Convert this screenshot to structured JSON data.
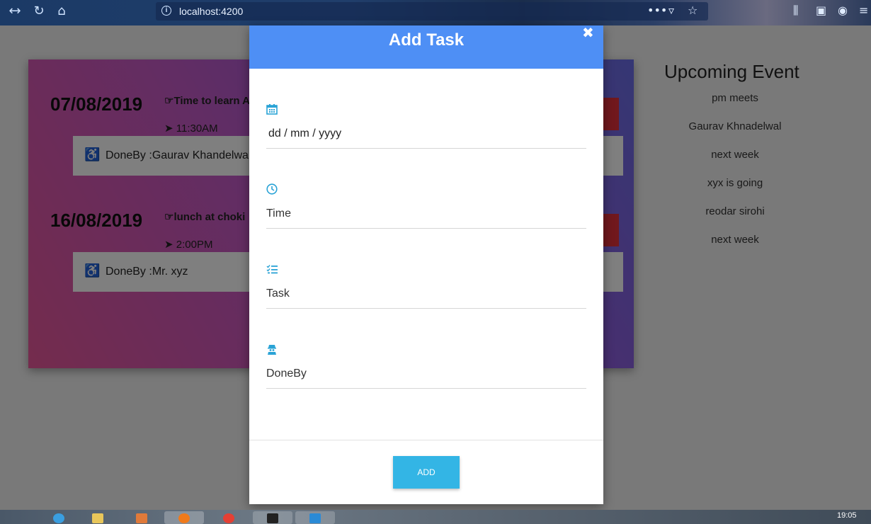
{
  "browser": {
    "url": "localhost:4200",
    "more_label": "•••"
  },
  "events": [
    {
      "date": "07/08/2019",
      "title": "Time to learn A",
      "time": "11:30AM",
      "done_by": "DoneBy :Gaurav Khandelwal"
    },
    {
      "date": "16/08/2019",
      "title": "lunch at choki",
      "time": "2:00PM",
      "done_by": "DoneBy :Mr. xyz"
    }
  ],
  "sidebar": {
    "title": "Upcoming Event",
    "items": [
      "pm meets",
      "Gaurav Khnadelwal",
      "next week",
      "xyx is going",
      "reodar sirohi",
      "next week"
    ]
  },
  "modal": {
    "title": "Add Task",
    "close_glyph": "✖",
    "fields": [
      {
        "icon": "calendar-icon",
        "value": "dd / mm / yyyy"
      },
      {
        "icon": "clock-icon",
        "placeholder": "Time"
      },
      {
        "icon": "task-list-icon",
        "placeholder": "Task"
      },
      {
        "icon": "user-secret-icon",
        "placeholder": "DoneBy"
      }
    ],
    "add_label": "ADD"
  },
  "taskbar": {
    "clock": "19:05"
  },
  "colors": {
    "modal_header": "#4e8ff5",
    "add_button": "#33b5e5",
    "icon_accent": "#2aa3d6"
  }
}
